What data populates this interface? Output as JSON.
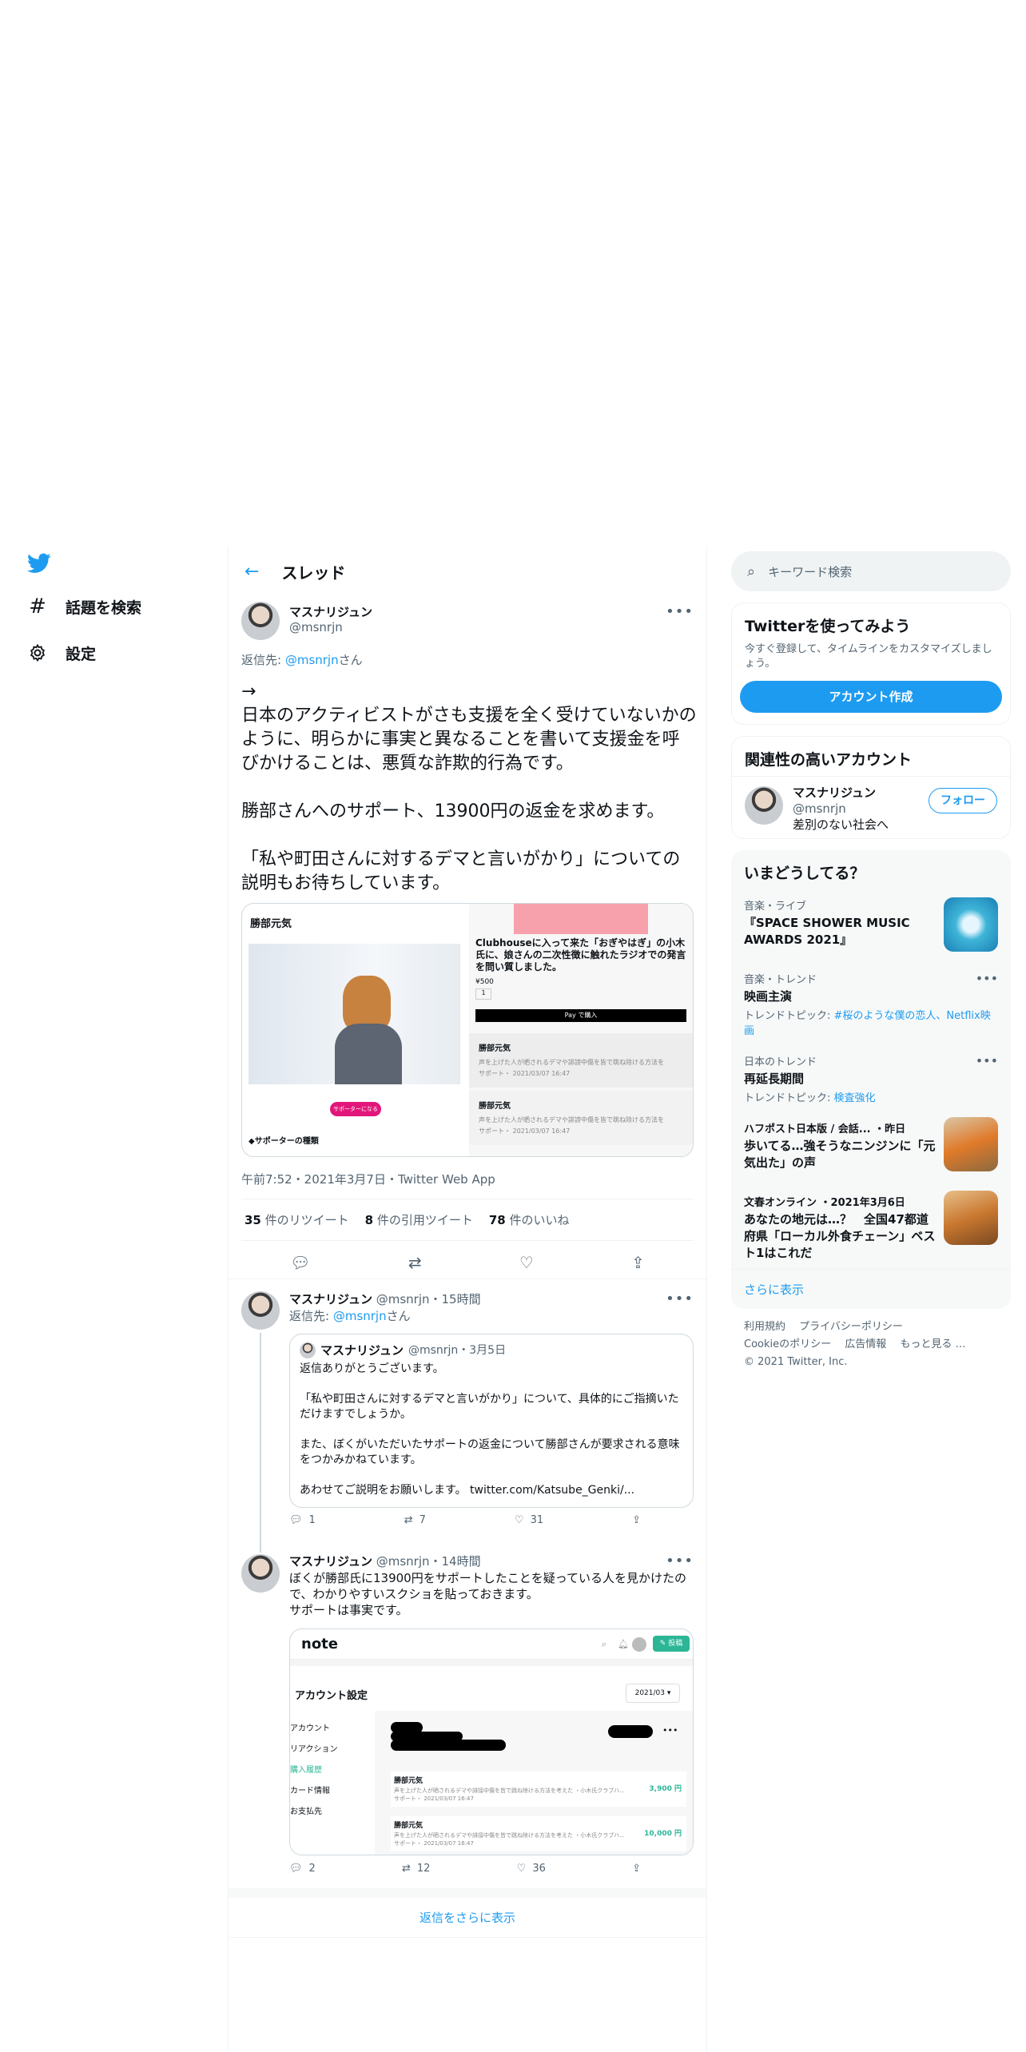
{
  "nav": {
    "items": [
      {
        "label": "話題を検索",
        "icon": "hash-icon"
      },
      {
        "label": "設定",
        "icon": "gear-icon"
      }
    ]
  },
  "header": {
    "title": "スレッド"
  },
  "main_tweet": {
    "name": "マスナリジュン",
    "handle": "@msnrjn",
    "reply_prefix": "返信先: ",
    "reply_to": "@msnrjn",
    "reply_suffix": "さん",
    "text": "→\n日本のアクティビストがさも支援を全く受けていないかのように、明らかに事実と異なることを書いて支援金を呼びかけることは、悪質な詐欺的行為です。\n\n勝部さんへのサポート、13900円の返金を求めます。\n\n「私や町田さんに対するデマと言いがかり」についての説明もお待ちしています。",
    "card": {
      "profile_name": "勝部元気",
      "support_button": "サポーターになる",
      "supporter_heading": "◆サポーターの種類",
      "article_title": "Clubhouseに入って来た「おぎやはぎ」の小木氏に、娘さんの二次性徴に触れたラジオでの発言を問い質しました。",
      "price": "¥500",
      "pay_button": " Pay で購入",
      "entries": [
        {
          "name": "勝部元気",
          "desc": "声を上げた人が晒されるデマや誹謗中傷を皆で跳ね除ける方法を",
          "date": "サポート・ 2021/03/07 16:47"
        },
        {
          "name": "勝部元気",
          "desc": "声を上げた人が晒されるデマや誹謗中傷を皆で跳ね除ける方法を",
          "date": "サポート・ 2021/03/07 16:47"
        }
      ]
    },
    "timestamp": "午前7:52・2021年3月7日・Twitter Web App",
    "retweets": "35",
    "retweets_label": " 件のリツイート",
    "quotes": "8",
    "quotes_label": " 件の引用ツイート",
    "likes": "78",
    "likes_label": " 件のいいね"
  },
  "replies": [
    {
      "name": "マスナリジュン",
      "meta": "@msnrjn・15時間",
      "reply_prefix": "返信先: ",
      "reply_to": "@msnrjn",
      "reply_suffix": "さん",
      "quote": {
        "name": "マスナリジュン",
        "meta": "@msnrjn・3月5日",
        "p1": "返信ありがとうございます。",
        "p2": "「私や町田さんに対するデマと言いがかり」について、具体的にご指摘いただけますでしょうか。",
        "p3": "また、ぼくがいただいたサポートの返金について勝部さんが要求される意味をつかみかねています。",
        "p4": "あわせてご説明をお願いします。 twitter.com/Katsube_Genki/..."
      },
      "replies": "1",
      "retweets": "7",
      "likes": "31"
    },
    {
      "name": "マスナリジュン",
      "meta": "@msnrjn・14時間",
      "text": "ぼくが勝部氏に13900円をサポートしたことを疑っている人を見かけたので、わかりやすいスクショを貼っておきます。\nサポートは事実です。",
      "screenshot": {
        "logo": "note",
        "post_button": "✎ 投稿",
        "settings_title": "アカウント設定",
        "month": "2021/03 ▾",
        "menu": [
          "アカウント",
          "リアクション",
          "購入履歴",
          "カード情報",
          "お支払先"
        ],
        "rows": [
          {
            "name": "勝部元気",
            "desc": "声を上げた人が晒されるデマや誹謗中傷を皆で跳ね除ける方法を考えた ・小木氏クラブハ...",
            "date": "サポート・ 2021/03/07 16:47",
            "amount": "3,900 円"
          },
          {
            "name": "勝部元気",
            "desc": "声を上げた人が晒されるデマや誹謗中傷を皆で跳ね除ける方法を考えた ・小木氏クラブハ...",
            "date": "サポート・ 2021/03/07 16:47",
            "amount": "10,000 円"
          }
        ]
      },
      "replies": "2",
      "retweets": "12",
      "likes": "36"
    }
  ],
  "show_more_replies": "返信をさらに表示",
  "sidebar": {
    "search_placeholder": "キーワード検索",
    "signup": {
      "title": "Twitterを使ってみよう",
      "desc": "今すぐ登録して、タイムラインをカスタマイズしましょう。",
      "button": "アカウント作成"
    },
    "related": {
      "title": "関連性の高いアカウント",
      "name": "マスナリジュン",
      "handle": "@msnrjn",
      "bio": "差別のない社会へ",
      "follow": "フォロー"
    },
    "trends": {
      "title": "いまどうしてる？",
      "items": [
        {
          "meta": "音楽・ライブ",
          "title": "『SPACE SHOWER MUSIC AWARDS 2021』"
        },
        {
          "meta": "音楽・トレンド",
          "title": "映画主演",
          "sub_prefix": "トレンドトピック: ",
          "sub": "#桜のような僕の恋人、Netflix映画"
        },
        {
          "meta": "日本のトレンド",
          "title": "再延長期間",
          "sub_prefix": "トレンドトピック: ",
          "sub": "検査強化"
        },
        {
          "meta": "ハフポスト日本版 / 会話... ・昨日",
          "title": "歩いてる…強そうなニンジンに「元気出た」の声"
        },
        {
          "meta": "文春オンライン ・2021年3月6日",
          "title": "あなたの地元は…？　全国47都道府県「ローカル外食チェーン」ベスト1はこれだ"
        }
      ],
      "show_more": "さらに表示"
    },
    "footer": [
      "利用規約",
      "プライバシーポリシー",
      "Cookieのポリシー",
      "広告情報",
      "もっと見る …",
      "© 2021 Twitter, Inc."
    ]
  },
  "colors": {
    "accent": "#1d9bf0",
    "text": "#0f1419",
    "secondary": "#536471",
    "border": "#eff3f4",
    "pink": "#e2167a"
  }
}
